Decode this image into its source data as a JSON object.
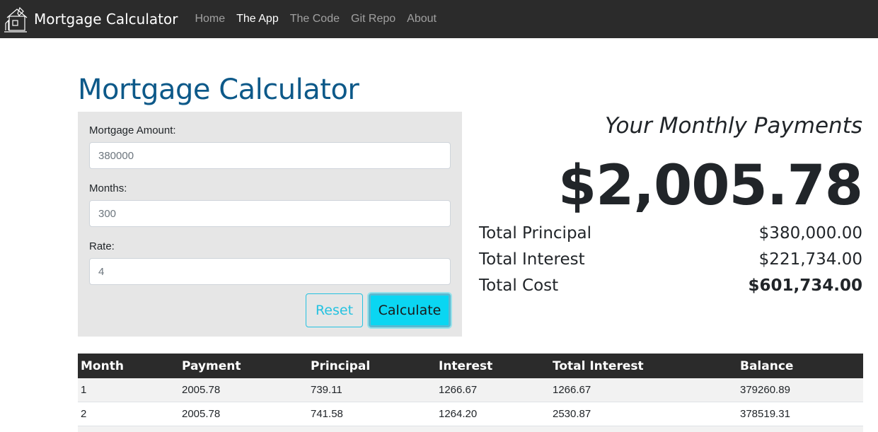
{
  "navbar": {
    "brand": "Mortgage Calculator",
    "logo_icon": "house-pen-logo-icon",
    "links": [
      {
        "label": "Home",
        "active": false
      },
      {
        "label": "The App",
        "active": true
      },
      {
        "label": "The Code",
        "active": false
      },
      {
        "label": "Git Repo",
        "active": false
      },
      {
        "label": "About",
        "active": false
      }
    ]
  },
  "page": {
    "title": "Mortgage Calculator"
  },
  "form": {
    "amount": {
      "label": "Mortgage Amount:",
      "value": "380000"
    },
    "months": {
      "label": "Months:",
      "value": "300"
    },
    "rate": {
      "label": "Rate:",
      "value": "4"
    },
    "reset_label": "Reset",
    "calculate_label": "Calculate"
  },
  "results": {
    "heading": "Your Monthly Payments",
    "monthly_payment": "$2,005.78",
    "total_principal_label": "Total Principal",
    "total_principal": "$380,000.00",
    "total_interest_label": "Total Interest",
    "total_interest": "$221,734.00",
    "total_cost_label": "Total Cost",
    "total_cost": "$601,734.00"
  },
  "table": {
    "headers": [
      "Month",
      "Payment",
      "Principal",
      "Interest",
      "Total Interest",
      "Balance"
    ],
    "rows": [
      [
        "1",
        "2005.78",
        "739.11",
        "1266.67",
        "1266.67",
        "379260.89"
      ],
      [
        "2",
        "2005.78",
        "741.58",
        "1264.20",
        "2530.87",
        "378519.31"
      ]
    ]
  },
  "colors": {
    "navbar_bg": "#2b2b2b",
    "title": "#0d5989",
    "panel_bg": "#e6e6e6",
    "accent_info": "#0ad6f2",
    "outline_info": "#25c2e0"
  }
}
